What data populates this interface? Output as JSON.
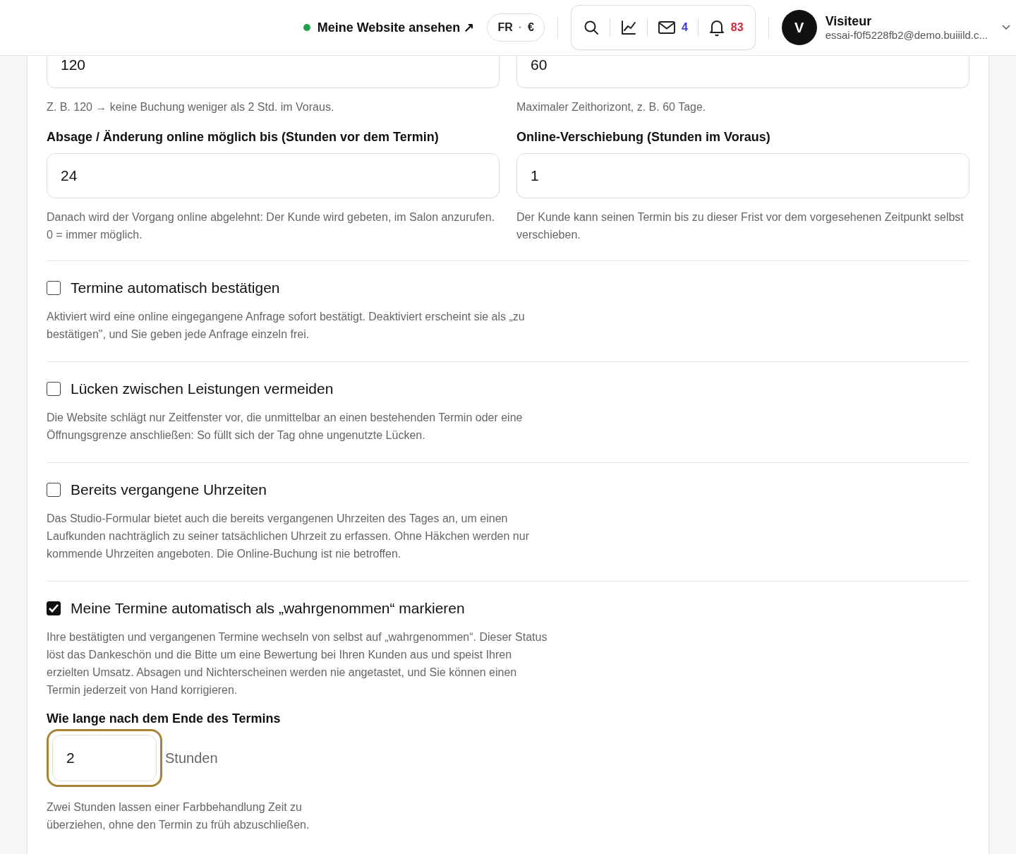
{
  "header": {
    "site_link": "Meine Website ansehen ↗",
    "site_online": true,
    "locale": {
      "lang": "FR",
      "separator": "·",
      "currency": "€"
    },
    "messages_count": "4",
    "notifications_count": "83",
    "user": {
      "initial": "V",
      "name": "Visiteur",
      "email": "essai-f0f5228fb2@demo.buiiild.c..."
    }
  },
  "fields_top": [
    {
      "value": "120",
      "help": "Z. B. 120 → keine Buchung weniger als 2 Std. im Voraus."
    },
    {
      "value": "60",
      "help": "Maximaler Zeithorizont, z. B. 60 Tage."
    }
  ],
  "fields": [
    {
      "label": "Absage / Änderung online möglich bis (Stunden vor dem Termin)",
      "value": "24",
      "help": "Danach wird der Vorgang online abgelehnt: Der Kunde wird gebeten, im Salon anzurufen. 0 = immer möglich."
    },
    {
      "label": "Online-Verschiebung (Stunden im Voraus)",
      "value": "1",
      "help": "Der Kunde kann seinen Termin bis zu dieser Frist vor dem vorgesehenen Zeitpunkt selbst verschieben."
    }
  ],
  "options": [
    {
      "label": "Termine automatisch bestätigen",
      "checked": false,
      "help": "Aktiviert wird eine online eingegangene Anfrage sofort bestätigt. Deaktiviert erscheint sie als „zu bestätigen\", und Sie geben jede Anfrage einzeln frei."
    },
    {
      "label": "Lücken zwischen Leistungen vermeiden",
      "checked": false,
      "help": "Die Website schlägt nur Zeitfenster vor, die unmittelbar an einen bestehenden Termin oder eine Öffnungsgrenze anschließen: So füllt sich der Tag ohne ungenutzte Lücken."
    },
    {
      "label": "Bereits vergangene Uhrzeiten",
      "checked": false,
      "help": "Das Studio-Formular bietet auch die bereits vergangenen Uhrzeiten des Tages an, um einen Laufkunden nachträglich zu seiner tatsächlichen Uhrzeit zu erfassen. Ohne Häkchen werden nur kommende Uhrzeiten angeboten. Die Online-Buchung ist nie betroffen."
    },
    {
      "label": "Meine Termine automatisch als „wahrgenommen“ markieren",
      "checked": true,
      "help": "Ihre bestätigten und vergangenen Termine wechseln von selbst auf „wahrgenommen“. Dieser Status löst das Dankeschön und die Bitte um eine Bewertung bei Ihren Kunden aus und speist Ihren erzielten Umsatz. Absagen und Nichterscheinen werden nie angetastet, und Sie können einen Termin jederzeit von Hand korrigieren.",
      "sub": {
        "label": "Wie lange nach dem Ende des Termins",
        "value": "2",
        "focused": true,
        "unit": "Stunden",
        "help": "Zwei Stunden lassen einer Farbbehandlung Zeit zu überziehen, ohne den Termin zu früh abzuschließen."
      }
    }
  ]
}
